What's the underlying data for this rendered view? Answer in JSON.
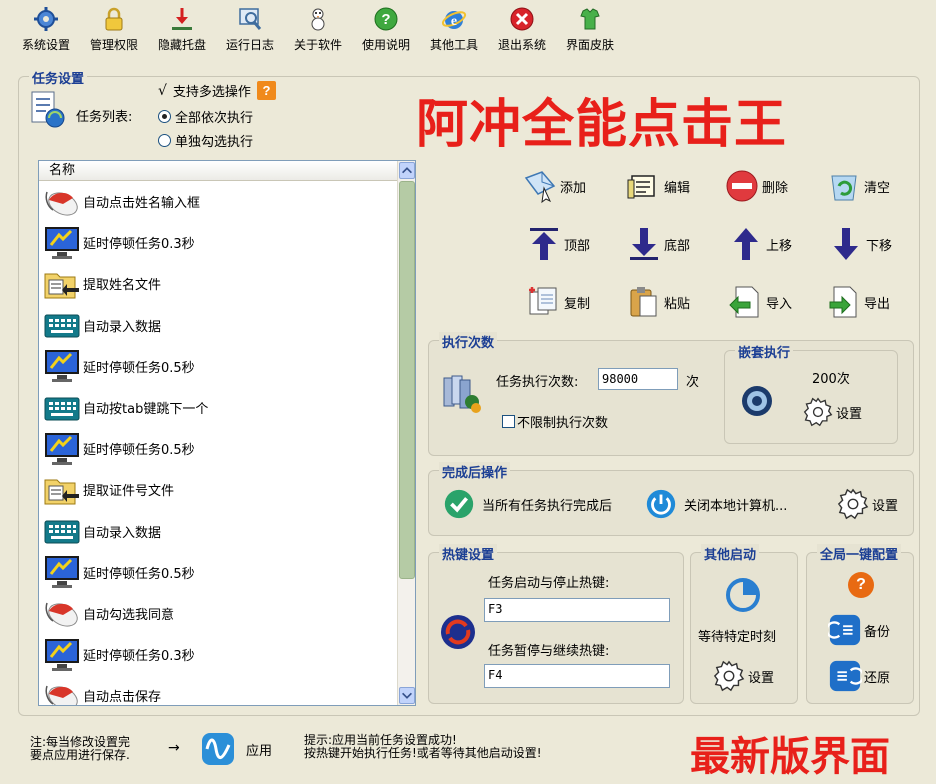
{
  "toolbar": [
    {
      "label": "系统设置",
      "icon": "gear-icon"
    },
    {
      "label": "管理权限",
      "icon": "lock-icon"
    },
    {
      "label": "隐藏托盘",
      "icon": "tray-down-icon"
    },
    {
      "label": "运行日志",
      "icon": "log-icon"
    },
    {
      "label": "关于软件",
      "icon": "about-icon"
    },
    {
      "label": "使用说明",
      "icon": "help-icon"
    },
    {
      "label": "其他工具",
      "icon": "ie-icon"
    },
    {
      "label": "退出系统",
      "icon": "exit-icon"
    },
    {
      "label": "界面皮肤",
      "icon": "skin-icon"
    }
  ],
  "task_settings": {
    "group_title": "任务设置",
    "task_list_label": "任务列表:",
    "multi_select_label": "支持多选操作",
    "multi_select_checkmark": "√",
    "help_mark": "?",
    "radio_all": "全部依次执行",
    "radio_single": "单独勾选执行",
    "list_header": "名称",
    "tasks": [
      {
        "label": "自动点击姓名输入框",
        "icon": "mouse-icon"
      },
      {
        "label": "延时停顿任务0.3秒",
        "icon": "monitor-delay-icon"
      },
      {
        "label": "提取姓名文件",
        "icon": "folder-extract-icon"
      },
      {
        "label": "自动录入数据",
        "icon": "keyboard-icon"
      },
      {
        "label": "延时停顿任务0.5秒",
        "icon": "monitor-delay-icon"
      },
      {
        "label": "自动按tab键跳下一个",
        "icon": "keyboard-icon"
      },
      {
        "label": "延时停顿任务0.5秒",
        "icon": "monitor-delay-icon"
      },
      {
        "label": "提取证件号文件",
        "icon": "folder-extract-icon"
      },
      {
        "label": "自动录入数据",
        "icon": "keyboard-icon"
      },
      {
        "label": "延时停顿任务0.5秒",
        "icon": "monitor-delay-icon"
      },
      {
        "label": "自动勾选我同意",
        "icon": "mouse-icon"
      },
      {
        "label": "延时停顿任务0.3秒",
        "icon": "monitor-delay-icon"
      },
      {
        "label": "自动点击保存",
        "icon": "mouse-icon"
      }
    ]
  },
  "banner_title": "阿冲全能点击王",
  "banner_footer": "最新版界面",
  "actions": {
    "add": "添加",
    "edit": "编辑",
    "delete": "删除",
    "clear": "清空",
    "top": "顶部",
    "bottom": "底部",
    "up": "上移",
    "down": "下移",
    "copy": "复制",
    "paste": "粘贴",
    "import": "导入",
    "export": "导出"
  },
  "exec_count": {
    "group_title": "执行次数",
    "label": "任务执行次数:",
    "value": "98000",
    "unit": "次",
    "unlimited_label": "不限制执行次数"
  },
  "nested": {
    "group_title": "嵌套执行",
    "count": "200次",
    "settings_label": "设置"
  },
  "after_complete": {
    "group_title": "完成后操作",
    "condition": "当所有任务执行完成后",
    "action": "关闭本地计算机...",
    "settings_label": "设置"
  },
  "hotkeys": {
    "group_title": "热键设置",
    "start_stop_label": "任务启动与停止热键:",
    "start_stop_value": "F3",
    "pause_resume_label": "任务暂停与继续热键:",
    "pause_resume_value": "F4"
  },
  "other_start": {
    "group_title": "其他启动",
    "wait_label": "等待特定时刻",
    "settings_label": "设置"
  },
  "global_config": {
    "group_title": "全局一键配置",
    "help_mark": "?",
    "backup_label": "备份",
    "restore_label": "还原"
  },
  "footer": {
    "note_line1": "注:每当修改设置完",
    "note_line2": "要点应用进行保存.",
    "arrow": "→",
    "apply_label": "应用",
    "tip_line1": "提示:应用当前任务设置成功!",
    "tip_line2": "按热键开始执行任务!或者等待其他启动设置!"
  },
  "colors": {
    "banner_red": "#e8201a",
    "group_title_blue": "#1c3f94",
    "background": "#ece9d8"
  }
}
